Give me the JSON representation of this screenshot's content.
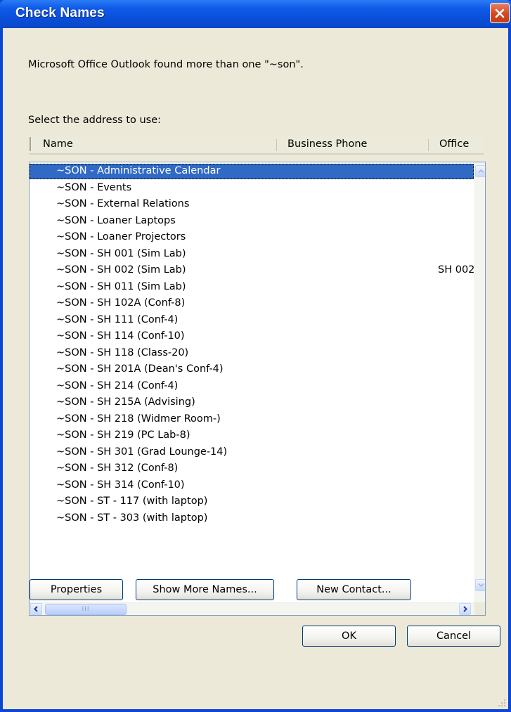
{
  "window": {
    "title": "Check Names"
  },
  "message": "Microsoft Office Outlook found more than one \"~son\".",
  "select_label": "Select the address to use:",
  "columns": [
    "Name",
    "Business Phone",
    "Office"
  ],
  "rows": [
    {
      "name": "~SON - Administrative Calendar",
      "office": "",
      "selected": true
    },
    {
      "name": "~SON - Events",
      "office": ""
    },
    {
      "name": "~SON - External Relations",
      "office": ""
    },
    {
      "name": "~SON - Loaner Laptops",
      "office": ""
    },
    {
      "name": "~SON - Loaner Projectors",
      "office": ""
    },
    {
      "name": "~SON - SH 001 (Sim Lab)",
      "office": ""
    },
    {
      "name": "~SON - SH 002 (Sim Lab)",
      "office": "SH 002"
    },
    {
      "name": "~SON - SH 011 (Sim Lab)",
      "office": ""
    },
    {
      "name": "~SON - SH 102A (Conf-8)",
      "office": ""
    },
    {
      "name": "~SON - SH 111 (Conf-4)",
      "office": ""
    },
    {
      "name": "~SON - SH 114 (Conf-10)",
      "office": ""
    },
    {
      "name": "~SON - SH 118 (Class-20)",
      "office": ""
    },
    {
      "name": "~SON - SH 201A (Dean's Conf-4)",
      "office": ""
    },
    {
      "name": "~SON - SH 214 (Conf-4)",
      "office": ""
    },
    {
      "name": "~SON - SH 215A (Advising)",
      "office": ""
    },
    {
      "name": "~SON - SH 218 (Widmer Room-)",
      "office": ""
    },
    {
      "name": "~SON - SH 219 (PC Lab-8)",
      "office": ""
    },
    {
      "name": "~SON - SH 301 (Grad Lounge-14)",
      "office": ""
    },
    {
      "name": "~SON - SH 312 (Conf-8)",
      "office": ""
    },
    {
      "name": "~SON - SH 314 (Conf-10)",
      "office": ""
    },
    {
      "name": "~SON - ST - 117 (with laptop)",
      "office": ""
    },
    {
      "name": "~SON - ST - 303 (with laptop)",
      "office": ""
    }
  ],
  "buttons": {
    "properties": "Properties",
    "show_more": "Show More Names...",
    "new_contact": "New Contact...",
    "ok": "OK",
    "cancel": "Cancel"
  },
  "scrollbar": {
    "grip_text": "III"
  },
  "colors": {
    "title_bar": "#0a4ed6",
    "selection": "#316ac5",
    "dialog_bg": "#ece9d8",
    "close_button": "#d2491f"
  },
  "icons": [
    "close-icon",
    "scroll-up-icon",
    "scroll-down-icon",
    "scroll-left-icon",
    "scroll-right-icon",
    "resize-grip-icon"
  ]
}
